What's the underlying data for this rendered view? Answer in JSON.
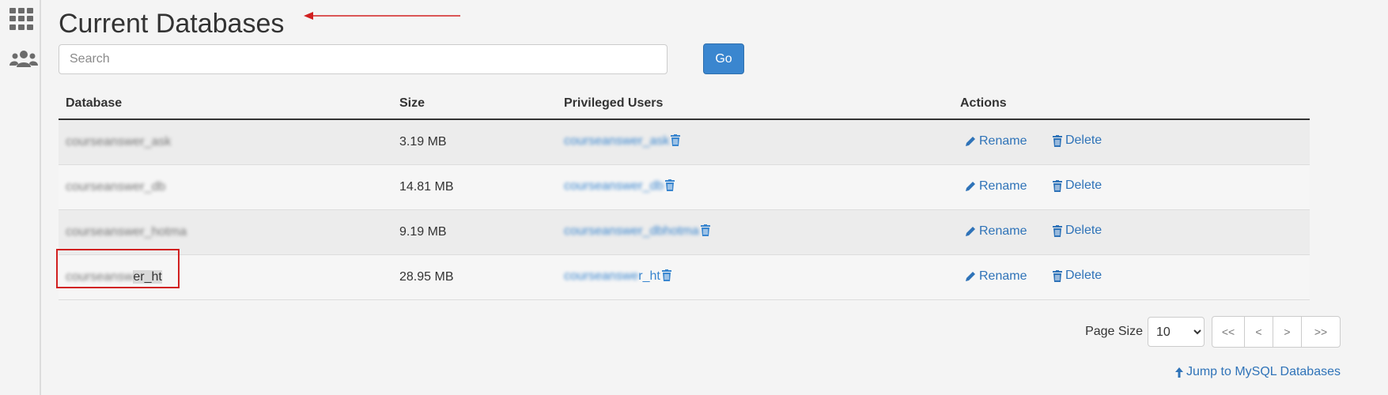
{
  "page": {
    "title": "Current Databases"
  },
  "search": {
    "placeholder": "Search",
    "value": "",
    "go_label": "Go"
  },
  "table": {
    "headers": {
      "database": "Database",
      "size": "Size",
      "users": "Privileged Users",
      "actions": "Actions"
    },
    "rows": [
      {
        "database": "courseanswer_ask",
        "size": "3.19 MB",
        "user": "courseanswer_ask"
      },
      {
        "database": "courseanswer_db",
        "size": "14.81 MB",
        "user": "courseanswer_db"
      },
      {
        "database": "courseanswer_hotma",
        "size": "9.19 MB",
        "user": "courseanswer_dbhotma"
      },
      {
        "database_hidden": "courseansw",
        "database_visible": "er_ht",
        "size": "28.95 MB",
        "user_hidden": "courseanswe",
        "user_visible": "r_ht"
      }
    ],
    "actions": {
      "rename": "Rename",
      "delete": "Delete"
    }
  },
  "pager": {
    "label": "Page Size",
    "selected": "10",
    "first": "<<",
    "prev": "<",
    "next": ">",
    "last": ">>"
  },
  "footer": {
    "jump_link": "Jump to MySQL Databases"
  },
  "colors": {
    "accent": "#3a86cf",
    "link": "#2f73b8",
    "annotation": "#d12020"
  },
  "icons": [
    "grid-icon",
    "users-icon",
    "pencil-icon",
    "trash-icon",
    "arrow-up-icon"
  ]
}
